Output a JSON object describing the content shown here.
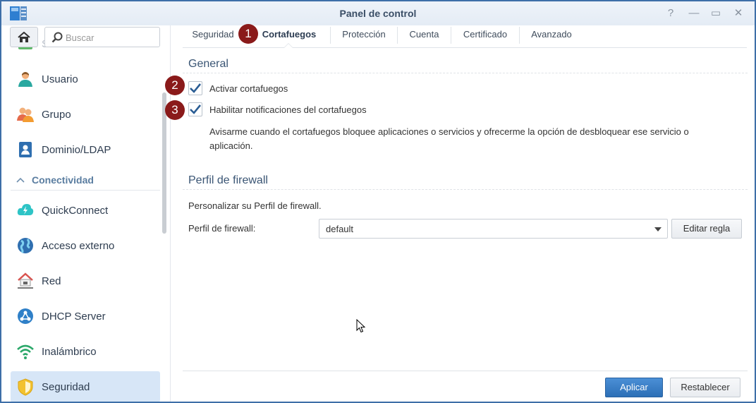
{
  "window": {
    "title": "Panel de control",
    "controls": {
      "help": "?",
      "minimize": "—",
      "maximize": "▭",
      "close": "✕"
    }
  },
  "sidebar": {
    "search": {
      "placeholder": "Buscar",
      "value": ""
    },
    "items": [
      {
        "label": "Servicios de archivos",
        "icon": "folder-icon",
        "faded": true
      },
      {
        "label": "Usuario",
        "icon": "user-icon"
      },
      {
        "label": "Grupo",
        "icon": "group-icon"
      },
      {
        "label": "Dominio/LDAP",
        "icon": "domain-icon"
      }
    ],
    "section": {
      "label": "Conectividad",
      "icon": "chevron-up-icon"
    },
    "items2": [
      {
        "label": "QuickConnect",
        "icon": "quickconnect-icon"
      },
      {
        "label": "Acceso externo",
        "icon": "globe-icon"
      },
      {
        "label": "Red",
        "icon": "network-house-icon"
      },
      {
        "label": "DHCP Server",
        "icon": "dhcp-icon"
      },
      {
        "label": "Inalámbrico",
        "icon": "wifi-icon"
      },
      {
        "label": "Seguridad",
        "icon": "shield-icon",
        "active": true
      }
    ]
  },
  "tabs": [
    {
      "label": "Seguridad"
    },
    {
      "label": "Cortafuegos",
      "active": true
    },
    {
      "label": "Protección"
    },
    {
      "label": "Cuenta"
    },
    {
      "label": "Certificado"
    },
    {
      "label": "Avanzado"
    }
  ],
  "badges": [
    "1",
    "2",
    "3"
  ],
  "general": {
    "title": "General",
    "enable_firewall": {
      "label": "Activar cortafuegos",
      "checked": true
    },
    "enable_notifications": {
      "label": "Habilitar notificaciones del cortafuegos",
      "checked": true
    },
    "description": "Avisarme cuando el cortafuegos bloquee aplicaciones o servicios y ofrecerme la opción de desbloquear ese servicio o aplicación."
  },
  "profile": {
    "title": "Perfil de firewall",
    "hint": "Personalizar su Perfil de firewall.",
    "field_label": "Perfil de firewall:",
    "selected": "default",
    "edit_button": "Editar regla"
  },
  "footer": {
    "apply": "Aplicar",
    "reset": "Restablecer"
  },
  "colors": {
    "accent": "#2c6fb6",
    "badge": "#8a1a1a",
    "active_nav": "#d7e6f7"
  }
}
